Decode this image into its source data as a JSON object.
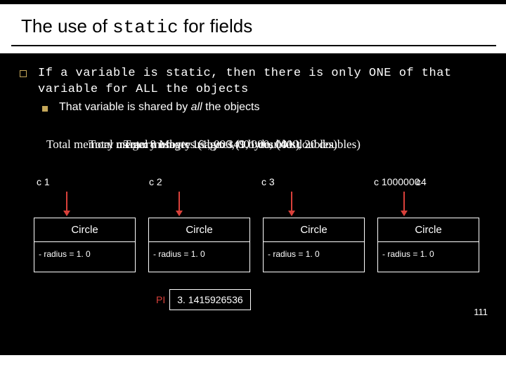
{
  "title_pre": "The use of ",
  "title_kw": "static",
  "title_post": " for fields",
  "bullet_pre": "If a variable is ",
  "bullet_kw": "static",
  "bullet_post": ", then there is only ONE of that variable for ALL the objects",
  "sub_bullet_pre": "That variable is shared by ",
  "sub_bullet_em": "all",
  "sub_bullet_post": " the objects",
  "overlap_a": "Total memory usage: 8 Mbytes (1, 000, 001 doubles)",
  "overlap_b": "Total memory usage: 16 bytes (1, 000, 001 doubles)",
  "overlap_c": "Total memory usage: 349 bytes (400, 20 doubles)",
  "labels": {
    "c1": "c 1",
    "c2": "c 2",
    "c3": "c 3",
    "c4a": "c 1000000",
    "c4b": "c4"
  },
  "box": {
    "head": "Circle",
    "field": "- radius = 1. 0"
  },
  "pi": {
    "label": "PI",
    "value": "3. 1415926536"
  },
  "page": "111"
}
